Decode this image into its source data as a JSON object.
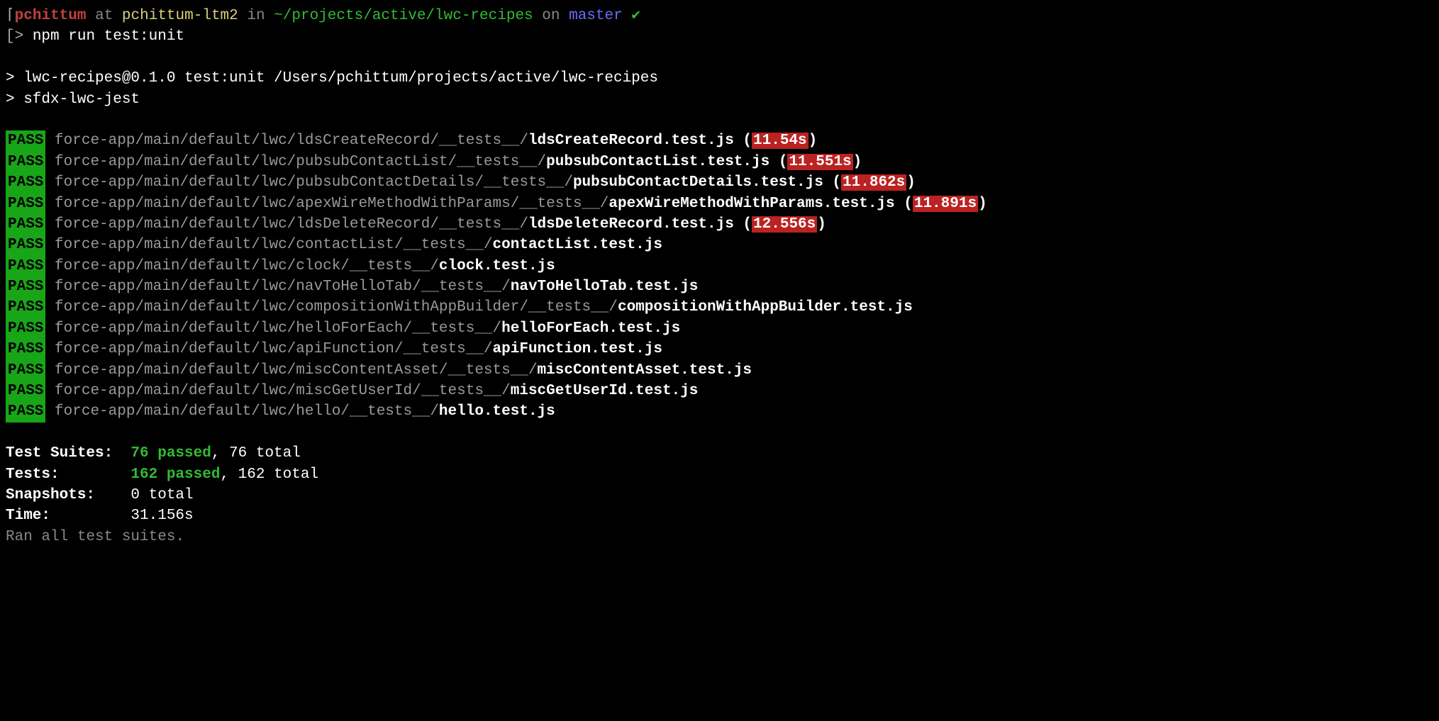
{
  "prompt": {
    "user": "pchittum",
    "at": "at",
    "host": "pchittum-ltm2",
    "in": "in",
    "path": "~/projects/active/lwc-recipes",
    "on": "on",
    "branch": "master",
    "check": "✔",
    "arrow1": "[>",
    "cmd": "npm run test:unit",
    "run1": "> lwc-recipes@0.1.0 test:unit /Users/pchittum/projects/active/lwc-recipes",
    "run2": "> sfdx-lwc-jest"
  },
  "pass_label": " PASS ",
  "tests": [
    {
      "path": "force-app/main/default/lwc/ldsCreateRecord/__tests__/",
      "file": "ldsCreateRecord.test.js",
      "duration": "11.54s"
    },
    {
      "path": "force-app/main/default/lwc/pubsubContactList/__tests__/",
      "file": "pubsubContactList.test.js",
      "duration": "11.551s"
    },
    {
      "path": "force-app/main/default/lwc/pubsubContactDetails/__tests__/",
      "file": "pubsubContactDetails.test.js",
      "duration": "11.862s"
    },
    {
      "path": "force-app/main/default/lwc/apexWireMethodWithParams/__tests__/",
      "file": "apexWireMethodWithParams.test.js",
      "duration": "11.891s"
    },
    {
      "path": "force-app/main/default/lwc/ldsDeleteRecord/__tests__/",
      "file": "ldsDeleteRecord.test.js",
      "duration": "12.556s"
    },
    {
      "path": "force-app/main/default/lwc/contactList/__tests__/",
      "file": "contactList.test.js"
    },
    {
      "path": "force-app/main/default/lwc/clock/__tests__/",
      "file": "clock.test.js"
    },
    {
      "path": "force-app/main/default/lwc/navToHelloTab/__tests__/",
      "file": "navToHelloTab.test.js"
    },
    {
      "path": "force-app/main/default/lwc/compositionWithAppBuilder/__tests__/",
      "file": "compositionWithAppBuilder.test.js"
    },
    {
      "path": "force-app/main/default/lwc/helloForEach/__tests__/",
      "file": "helloForEach.test.js"
    },
    {
      "path": "force-app/main/default/lwc/apiFunction/__tests__/",
      "file": "apiFunction.test.js"
    },
    {
      "path": "force-app/main/default/lwc/miscContentAsset/__tests__/",
      "file": "miscContentAsset.test.js"
    },
    {
      "path": "force-app/main/default/lwc/miscGetUserId/__tests__/",
      "file": "miscGetUserId.test.js"
    },
    {
      "path": "force-app/main/default/lwc/hello/__tests__/",
      "file": "hello.test.js"
    }
  ],
  "summary": {
    "suites_label": "Test Suites:",
    "suites_passed": "76 passed",
    "suites_total": ", 76 total",
    "tests_label": "Tests:",
    "tests_passed": "162 passed",
    "tests_total": ", 162 total",
    "snapshots_label": "Snapshots:",
    "snapshots_value": "0 total",
    "time_label": "Time:",
    "time_value": "31.156s",
    "ran": "Ran all test suites."
  }
}
